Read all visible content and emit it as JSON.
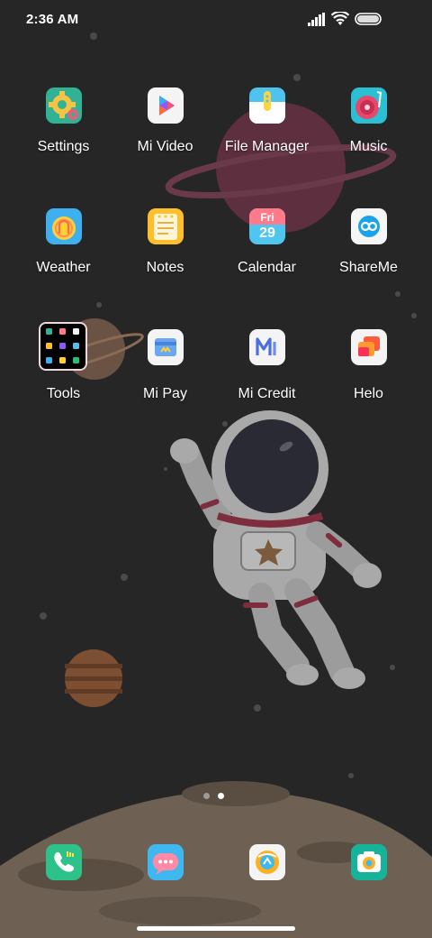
{
  "status_bar": {
    "time": "2:36 AM",
    "icons": [
      "signal-icon",
      "wifi-icon",
      "battery-icon"
    ]
  },
  "home_screen": {
    "apps": [
      {
        "label": "Settings",
        "icon": "settings-icon"
      },
      {
        "label": "Mi Video",
        "icon": "mi-video-icon"
      },
      {
        "label": "File Manager",
        "icon": "file-manager-icon"
      },
      {
        "label": "Music",
        "icon": "music-icon"
      },
      {
        "label": "Weather",
        "icon": "weather-icon"
      },
      {
        "label": "Notes",
        "icon": "notes-icon"
      },
      {
        "label": "Calendar",
        "icon": "calendar-icon",
        "day": "Fri",
        "date": "29"
      },
      {
        "label": "ShareMe",
        "icon": "shareme-icon"
      },
      {
        "label": "Tools",
        "icon": "folder-icon"
      },
      {
        "label": "Mi Pay",
        "icon": "mi-pay-icon"
      },
      {
        "label": "Mi Credit",
        "icon": "mi-credit-icon"
      },
      {
        "label": "Helo",
        "icon": "helo-icon"
      }
    ]
  },
  "page_indicator": {
    "pages": 2,
    "current": 2
  },
  "dock": [
    {
      "name": "phone",
      "icon": "phone-icon"
    },
    {
      "name": "messages",
      "icon": "messages-icon"
    },
    {
      "name": "browser",
      "icon": "browser-icon"
    },
    {
      "name": "camera",
      "icon": "camera-icon"
    }
  ],
  "colors": {
    "background": "#262626",
    "planet": "#5e2f3e",
    "moon": "#6e6052",
    "astronaut": "#a9a9a9",
    "accent_red": "#7d2d3d"
  }
}
